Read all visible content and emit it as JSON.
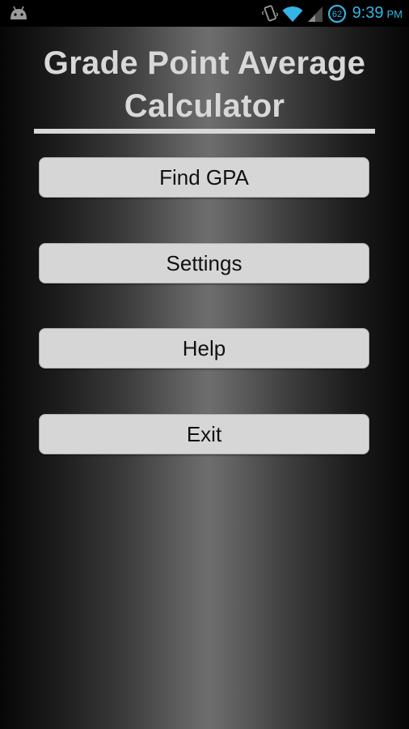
{
  "status_bar": {
    "notification_icon": "android-robot-icon",
    "icons": [
      "vibrate-icon",
      "wifi-icon",
      "signal-icon",
      "battery-icon"
    ],
    "battery_level": "62",
    "time": "9:39",
    "ampm": "PM",
    "clock_color": "#33b5e5"
  },
  "header": {
    "title_line1": "Grade Point Average",
    "title_line2": "Calculator"
  },
  "menu": {
    "find_gpa_label": "Find GPA",
    "settings_label": "Settings",
    "help_label": "Help",
    "exit_label": "Exit"
  }
}
